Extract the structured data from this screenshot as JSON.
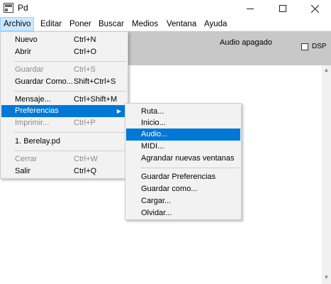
{
  "window": {
    "title": "Pd"
  },
  "menubar": [
    "Archivo",
    "Editar",
    "Poner",
    "Buscar",
    "Medios",
    "Ventana",
    "Ayuda"
  ],
  "toolbar": {
    "audio_status": "Audio apagado",
    "dsp_label": "DSP"
  },
  "archivo_menu": [
    {
      "label": "Nuevo",
      "shortcut": "Ctrl+N"
    },
    {
      "label": "Abrir",
      "shortcut": "Ctrl+O"
    },
    {
      "label": "Guardar",
      "shortcut": "Ctrl+S"
    },
    {
      "label": "Guardar Como...",
      "shortcut": "Shift+Ctrl+S"
    },
    {
      "label": "Mensaje...",
      "shortcut": "Ctrl+Shift+M"
    },
    {
      "label": "Preferencias",
      "shortcut": ""
    },
    {
      "label": "Imprimir...",
      "shortcut": "Ctrl+P"
    },
    {
      "label": "1. Berelay.pd",
      "shortcut": ""
    },
    {
      "label": "Cerrar",
      "shortcut": "Ctrl+W"
    },
    {
      "label": "Salir",
      "shortcut": "Ctrl+Q"
    }
  ],
  "preferencias_menu": [
    "Ruta...",
    "Inicio...",
    "Audio...",
    "MIDI...",
    "Agrandar nuevas ventanas",
    "Guardar Preferencias",
    "Guardar como...",
    "Cargar...",
    "Olvidar..."
  ]
}
